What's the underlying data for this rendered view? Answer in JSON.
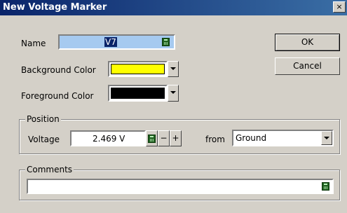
{
  "window": {
    "title": "New Voltage Marker",
    "close_glyph": "×"
  },
  "name_field": {
    "label": "Name",
    "value": "V7"
  },
  "background_color": {
    "label": "Background Color",
    "color": "#ffff00"
  },
  "foreground_color": {
    "label": "Foreground Color",
    "color": "#000000"
  },
  "position": {
    "group_label": "Position",
    "voltage_label": "Voltage",
    "voltage_value": "2.469 V",
    "minus_label": "−",
    "plus_label": "+",
    "from_label": "from",
    "reference_value": "Ground"
  },
  "comments": {
    "group_label": "Comments",
    "value": ""
  },
  "buttons": {
    "ok_label": "OK",
    "cancel_label": "Cancel"
  },
  "colors": {
    "title_bar": "#0a246a",
    "dialog_bg": "#d4d0c8"
  }
}
